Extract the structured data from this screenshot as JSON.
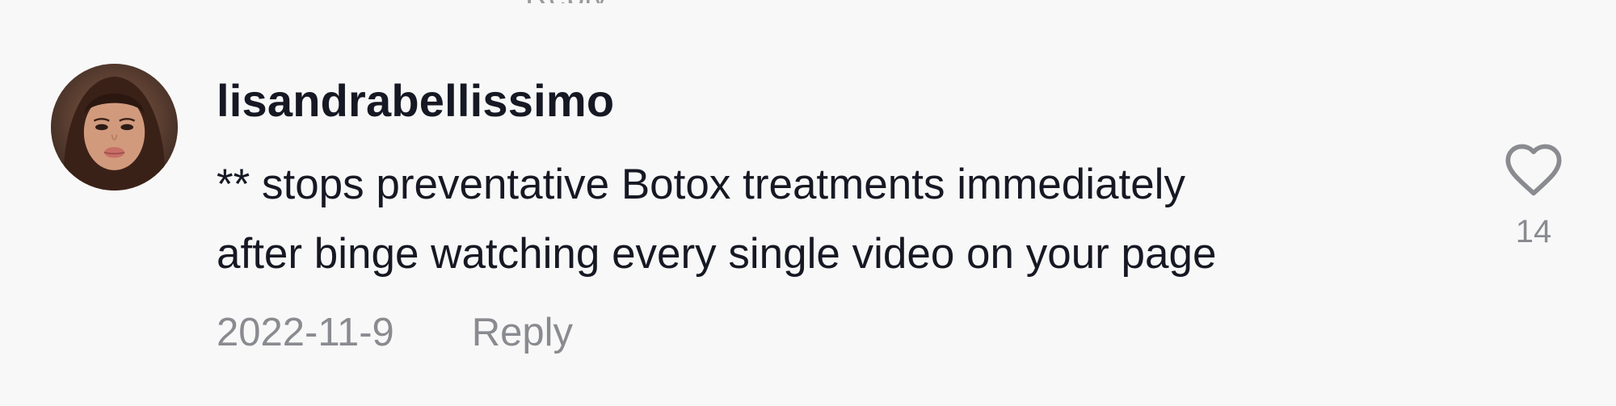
{
  "comment": {
    "username": "lisandrabellissimo",
    "text_lines": [
      "** stops preventative Botox treatments immediately",
      "after binge watching every single video on your page"
    ],
    "date": "2022-11-9",
    "reply_label": "Reply",
    "like_count": "14"
  },
  "icons": {
    "avatar": "user-avatar",
    "like": "heart-outline-icon"
  },
  "colors": {
    "background": "#f8f8f8",
    "primary_text": "#161823",
    "secondary_text": "#8a8b91"
  }
}
